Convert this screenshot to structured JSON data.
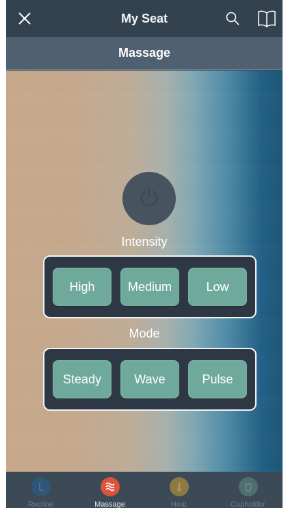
{
  "header": {
    "title": "My Seat",
    "close_icon": "close-icon",
    "search_icon": "search-icon",
    "book_icon": "book-icon"
  },
  "section": {
    "title": "Massage"
  },
  "controls": {
    "power_icon": "power-icon",
    "intensity_label": "Intensity",
    "intensity_options": [
      "High",
      "Medium",
      "Low"
    ],
    "mode_label": "Mode",
    "mode_options": [
      "Steady",
      "Wave",
      "Pulse"
    ]
  },
  "tabs": [
    {
      "label": "Recline",
      "icon": "recline-icon",
      "color": "#2f5676",
      "active": false
    },
    {
      "label": "Massage",
      "icon": "massage-waves-icon",
      "color": "#d9533d",
      "active": true
    },
    {
      "label": "Heat",
      "icon": "thermometer-icon",
      "color": "#8d7a43",
      "active": false
    },
    {
      "label": "Cupholder",
      "icon": "cupholder-icon",
      "color": "#4f6e6e",
      "active": false
    }
  ],
  "colors": {
    "accent_button": "#6ea99b",
    "active_tab": "#d9533d"
  }
}
